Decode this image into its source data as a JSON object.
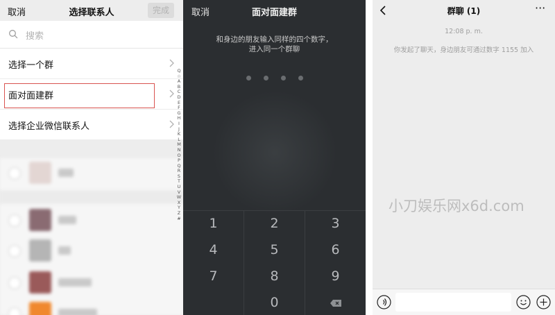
{
  "left_panel": {
    "cancel_label": "取消",
    "title": "选择联系人",
    "done_label": "完成",
    "search_placeholder": "搜索",
    "options": [
      {
        "label": "选择一个群"
      },
      {
        "label": "面对面建群"
      },
      {
        "label": "选择企业微信联系人"
      }
    ],
    "index_letters": [
      "Q",
      "☆",
      "A",
      "B",
      "C",
      "D",
      "E",
      "F",
      "G",
      "H",
      "I",
      "J",
      "K",
      "L",
      "M",
      "N",
      "O",
      "P",
      "Q",
      "R",
      "S",
      "T",
      "U",
      "V",
      "W",
      "X",
      "Y",
      "Z",
      "#"
    ]
  },
  "middle_panel": {
    "cancel_label": "取消",
    "title": "面对面建群",
    "instruction_line1": "和身边的朋友输入同样的四个数字，",
    "instruction_line2": "进入同一个群聊",
    "keys": [
      "1",
      "2",
      "3",
      "4",
      "5",
      "6",
      "7",
      "8",
      "9",
      "0"
    ]
  },
  "right_panel": {
    "title": "群聊 (1)",
    "more_label": "···",
    "time": "12:08 p. m.",
    "system_message": "你发起了聊天，身边朋友可通过数字 1155 加入"
  },
  "watermark": "小刀娱乐网x6d.com",
  "colors": {
    "highlight_border": "#d9534f",
    "dark_panel_bg": "#2b2e31",
    "light_bg": "#ededed"
  }
}
